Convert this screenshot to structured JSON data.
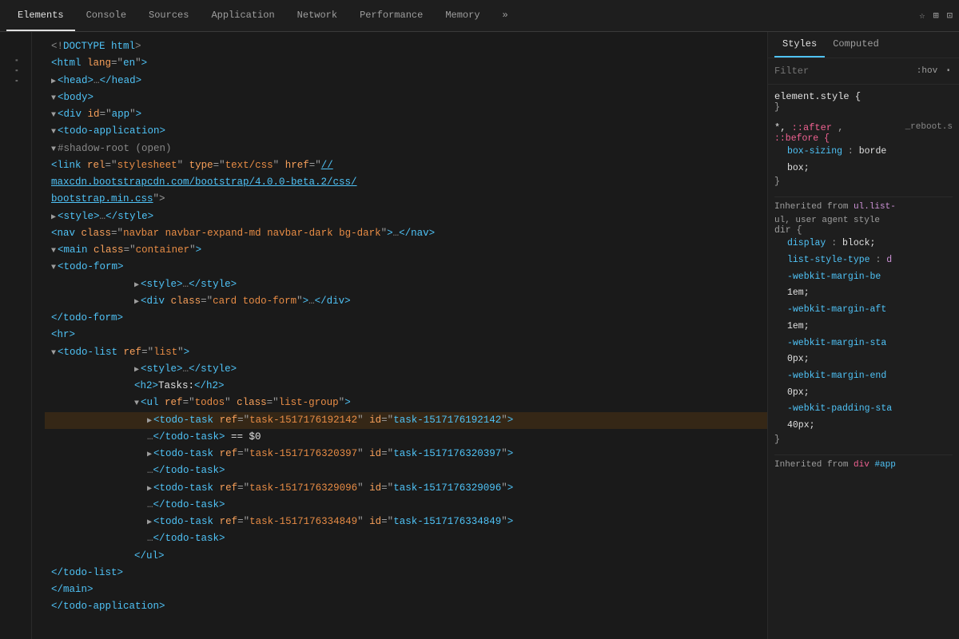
{
  "toolbar": {
    "tabs": [
      {
        "id": "elements",
        "label": "Elements",
        "active": true
      },
      {
        "id": "console",
        "label": "Console"
      },
      {
        "id": "sources",
        "label": "Sources"
      },
      {
        "id": "application",
        "label": "Application"
      },
      {
        "id": "network",
        "label": "Network"
      },
      {
        "id": "performance",
        "label": "Performance"
      },
      {
        "id": "memory",
        "label": "Memory"
      },
      {
        "id": "more",
        "label": "»"
      }
    ],
    "right_icons": [
      "star-icon",
      "bookmark-icon",
      "window-icon"
    ]
  },
  "dom": {
    "lines": [
      {
        "indent": 0,
        "content": "<!DOCTYPE html>"
      },
      {
        "indent": 0,
        "content": "<html lang=\"en\">"
      },
      {
        "indent": 1,
        "content": "▶<head>…</head>"
      },
      {
        "indent": 1,
        "content": "▼<body>"
      },
      {
        "indent": 2,
        "content": "▼<div id=\"app\">"
      },
      {
        "indent": 3,
        "content": "▼<todo-application>"
      },
      {
        "indent": 4,
        "content": "▼#shadow-root (open)"
      },
      {
        "indent": 5,
        "content": "<link rel=\"stylesheet\" type=\"text/css\" href=\"//"
      },
      {
        "indent": 5,
        "content": "maxcdn.bootstrapcdn.com/bootstrap/4.0.0-beta.2/css/"
      },
      {
        "indent": 5,
        "content": "bootstrap.min.css\">"
      },
      {
        "indent": 5,
        "content": "▶<style>…</style>"
      },
      {
        "indent": 5,
        "content": "<nav class=\"navbar navbar-expand-md navbar-dark bg-dark\">…</nav>"
      },
      {
        "indent": 5,
        "content": "▼<main class=\"container\">"
      },
      {
        "indent": 6,
        "content": "▼<todo-form>"
      },
      {
        "indent": 7,
        "content": "▶<style>…</style>"
      },
      {
        "indent": 7,
        "content": "▶<div class=\"card todo-form\">…</div>"
      },
      {
        "indent": 6,
        "content": "</todo-form>"
      },
      {
        "indent": 6,
        "content": "<hr>"
      },
      {
        "indent": 6,
        "content": "▼<todo-list ref=\"list\">"
      },
      {
        "indent": 7,
        "content": "▶<style>…</style>"
      },
      {
        "indent": 7,
        "content": "<h2>Tasks:</h2>"
      },
      {
        "indent": 7,
        "content": "▼<ul ref=\"todos\" class=\"list-group\">"
      },
      {
        "indent": 8,
        "content": "▶<todo-task ref=\"task-1517176192142\" id=\"task-1517176192142\">"
      },
      {
        "indent": 8,
        "content": "…</todo-task> == $0"
      },
      {
        "indent": 8,
        "content": "▶<todo-task ref=\"task-1517176320397\" id=\"task-1517176320397\">"
      },
      {
        "indent": 8,
        "content": "…</todo-task>"
      },
      {
        "indent": 8,
        "content": "▶<todo-task ref=\"task-1517176329096\" id=\"task-1517176329096\">"
      },
      {
        "indent": 8,
        "content": "…</todo-task>"
      },
      {
        "indent": 8,
        "content": "▶<todo-task ref=\"task-1517176334849\" id=\"task-1517176334849\">"
      },
      {
        "indent": 8,
        "content": "…</todo-task>"
      },
      {
        "indent": 7,
        "content": "</ul>"
      },
      {
        "indent": 6,
        "content": "</todo-list>"
      },
      {
        "indent": 5,
        "content": "</main>"
      },
      {
        "indent": 4,
        "content": "</todo-application>"
      }
    ]
  },
  "styles": {
    "tabs": [
      {
        "label": "Styles",
        "active": true
      },
      {
        "label": "Computed"
      }
    ],
    "filter_placeholder": "Filter",
    "filter_hov": ":hov",
    "filter_dot": "·",
    "blocks": [
      {
        "selector": "element.style {",
        "closing": "}",
        "props": []
      },
      {
        "selector": "*, ::after, ::before {",
        "source": "reboot.s",
        "props": [
          {
            "name": "box-sizing",
            "value": "borde",
            "webkit": false
          },
          {
            "name": "",
            "value": "box;",
            "webkit": false
          }
        ]
      }
    ],
    "inherited": {
      "label": "Inherited from",
      "selector_pink": "ul.list-",
      "ul_label": "ul, user agent style",
      "dir_label": "dir {",
      "props": [
        {
          "name": "display:",
          "value": "block;"
        },
        {
          "name": "list-style-type:",
          "value": "d",
          "webkit_suffix": true
        },
        {
          "name": "-webkit-margin-be",
          "value": "1em;"
        },
        {
          "name": "-webkit-margin-aft",
          "value": "1em;"
        },
        {
          "name": "-webkit-margin-sta",
          "value": "0px;"
        },
        {
          "name": "-webkit-margin-end",
          "value": "0px;"
        },
        {
          "name": "-webkit-padding-sta",
          "value": "40px;"
        }
      ]
    },
    "inherited2": {
      "label": "Inherited from",
      "selector": "div#app"
    }
  },
  "sidebar": {
    "dots": "···"
  }
}
